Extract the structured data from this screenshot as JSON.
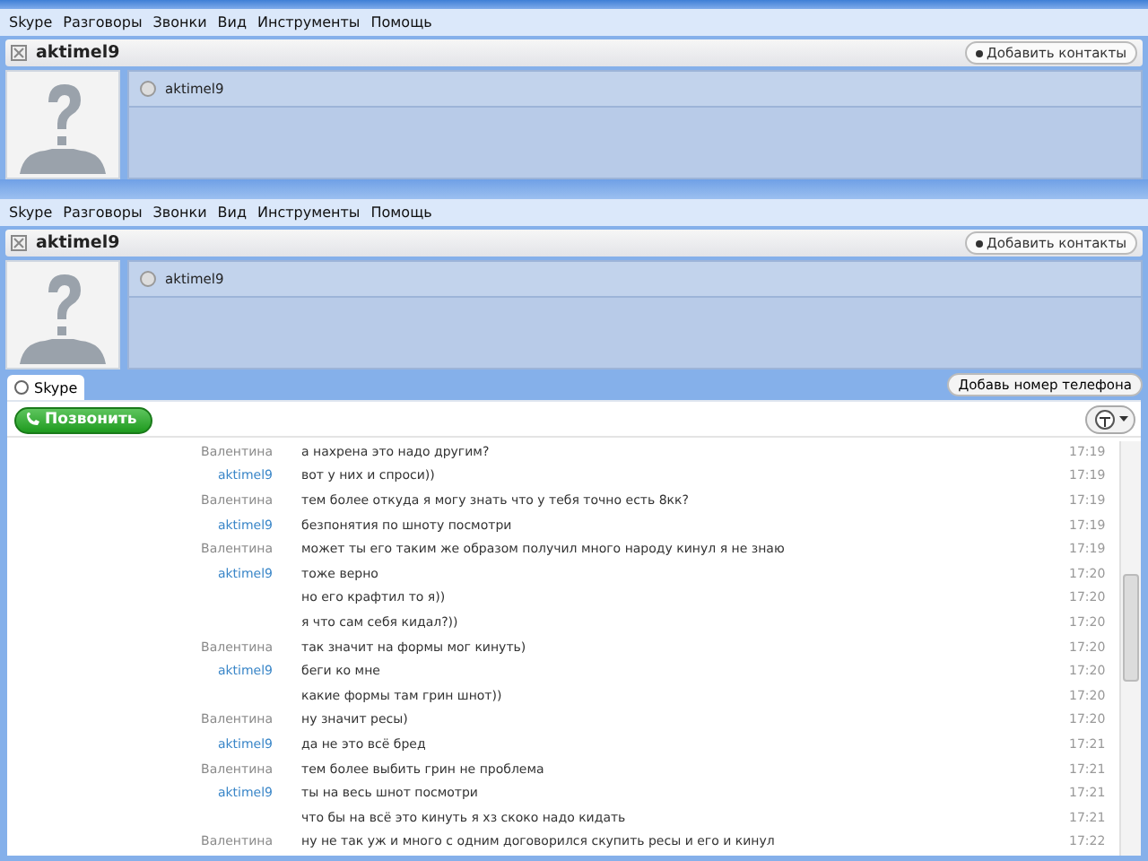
{
  "windows": [
    {
      "menu": [
        "Skype",
        "Разговоры",
        "Звонки",
        "Вид",
        "Инструменты",
        "Помощь"
      ],
      "contact_name": "aktimel9",
      "add_button": "Добавить контакты",
      "skype_name": "aktimel9"
    },
    {
      "menu": [
        "Skype",
        "Разговоры",
        "Звонки",
        "Вид",
        "Инструменты",
        "Помощь"
      ],
      "contact_name": "aktimel9",
      "add_button": "Добавить контакты",
      "skype_name": "aktimel9"
    }
  ],
  "tabs": [
    {
      "label": "Skype",
      "selected": true
    }
  ],
  "phone_button": "Добавь номер телефона",
  "call_button": "Позвонить",
  "messages": [
    {
      "sender": "Валентина",
      "kind": "incoming",
      "text": "а нахрена это надо другим?",
      "time": "17:19"
    },
    {
      "sender": "aktimel9",
      "kind": "outgoing",
      "text": "вот у них и спроси))",
      "time": "17:19"
    },
    {
      "sender": "Валентина",
      "kind": "incoming",
      "text": "тем более откуда я могу знать что у тебя точно есть 8кк?",
      "time": "17:19"
    },
    {
      "sender": "aktimel9",
      "kind": "outgoing",
      "text": "безпонятия по шноту посмотри",
      "time": "17:19"
    },
    {
      "sender": "Валентина",
      "kind": "incoming",
      "text": "может ты его таким же образом получил много народу кинул я не знаю",
      "time": "17:19"
    },
    {
      "sender": "aktimel9",
      "kind": "outgoing",
      "text": "тоже верно",
      "time": "17:20"
    },
    {
      "text": "но его крафтил то я))",
      "time": "17:20"
    },
    {
      "text": "я что сам себя кидал?))",
      "time": "17:20"
    },
    {
      "sender": "Валентина",
      "kind": "incoming",
      "text": "так значит на формы мог кинуть)",
      "time": "17:20"
    },
    {
      "sender": "aktimel9",
      "kind": "outgoing",
      "text": "беги ко мне",
      "time": "17:20"
    },
    {
      "text": "какие формы там грин шнот))",
      "time": "17:20"
    },
    {
      "sender": "Валентина",
      "kind": "incoming",
      "text": "ну значит ресы)",
      "time": "17:20"
    },
    {
      "sender": "aktimel9",
      "kind": "outgoing",
      "text": "да не это всё бред",
      "time": "17:21"
    },
    {
      "sender": "Валентина",
      "kind": "incoming",
      "text": "тем более выбить грин не проблема",
      "time": "17:21"
    },
    {
      "sender": "aktimel9",
      "kind": "outgoing",
      "text": "ты на весь шнот посмотри",
      "time": "17:21"
    },
    {
      "text": "что бы на всё это кинуть я хз скоко надо кидать",
      "time": "17:21"
    },
    {
      "sender": "Валентина",
      "kind": "incoming",
      "text": "ну не так уж и много с одним договорился скупить ресы и его и кинул",
      "time": "17:22"
    }
  ]
}
